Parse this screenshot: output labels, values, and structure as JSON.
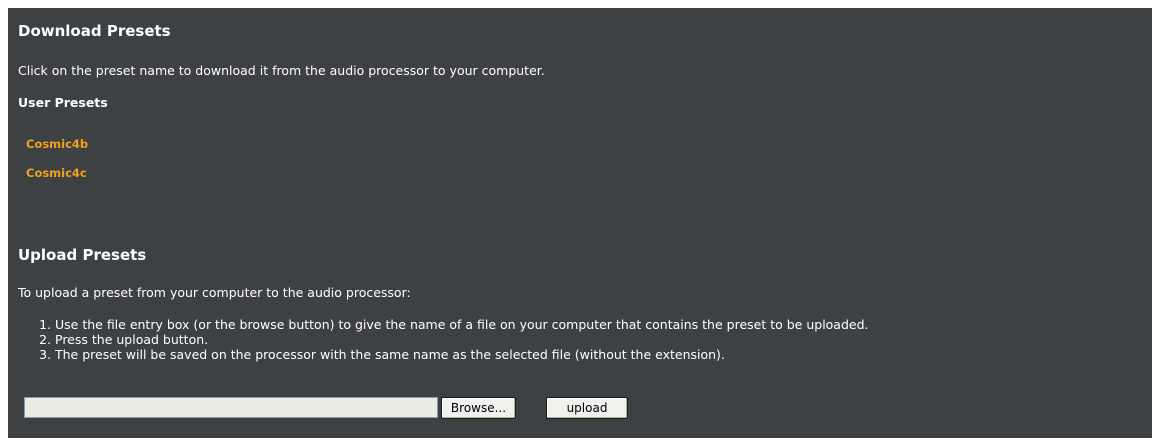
{
  "download": {
    "title": "Download Presets",
    "description": "Click on the preset name to download it from the audio processor to your computer.",
    "user_presets_label": "User Presets",
    "presets": [
      "Cosmic4b",
      "Cosmic4c"
    ]
  },
  "upload": {
    "title": "Upload Presets",
    "intro": "To upload a preset from your computer to the audio processor:",
    "steps": [
      "Use the file entry box (or the browse button) to give the name of a file on your computer that contains the preset to be uploaded.",
      "Press the upload button.",
      "The preset will be saved on the processor with the same name as the selected file (without the extension)."
    ],
    "file_value": "",
    "browse_label": "Browse...",
    "upload_label": "upload"
  }
}
